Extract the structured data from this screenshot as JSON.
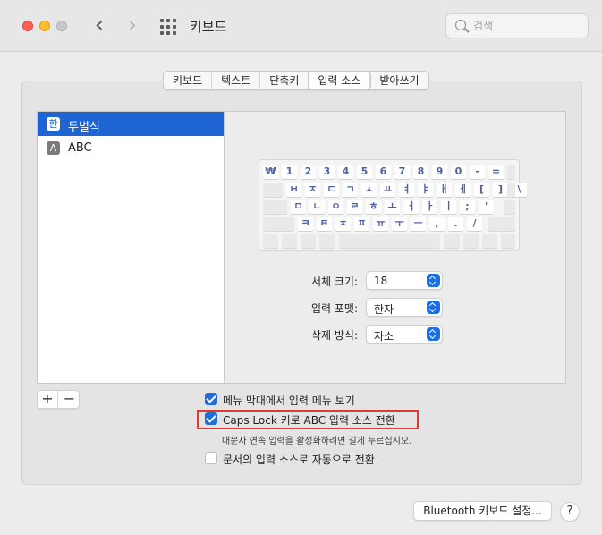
{
  "window": {
    "title": "키보드"
  },
  "search": {
    "placeholder": "검색",
    "value": ""
  },
  "tabs": [
    {
      "label": "키보드",
      "active": false
    },
    {
      "label": "텍스트",
      "active": false
    },
    {
      "label": "단축키",
      "active": false
    },
    {
      "label": "입력 소스",
      "active": true
    },
    {
      "label": "받아쓰기",
      "active": false
    }
  ],
  "sources": [
    {
      "icon": "한",
      "label": "두벌식",
      "selected": true
    },
    {
      "icon": "A",
      "label": "ABC",
      "selected": false
    }
  ],
  "keyboard": {
    "rows": [
      [
        "₩",
        "1",
        "2",
        "3",
        "4",
        "5",
        "6",
        "7",
        "8",
        "9",
        "0",
        "-",
        "="
      ],
      [
        "ㅂ",
        "ㅈ",
        "ㄷ",
        "ㄱ",
        "ㅅ",
        "ㅛ",
        "ㅕ",
        "ㅑ",
        "ㅐ",
        "ㅔ",
        "[",
        "]",
        "\\"
      ],
      [
        "ㅁ",
        "ㄴ",
        "ㅇ",
        "ㄹ",
        "ㅎ",
        "ㅗ",
        "ㅓ",
        "ㅏ",
        "ㅣ",
        ";",
        "'"
      ],
      [
        "ㅋ",
        "ㅌ",
        "ㅊ",
        "ㅍ",
        "ㅠ",
        "ㅜ",
        "ㅡ",
        ",",
        ".",
        "/"
      ]
    ]
  },
  "settings": {
    "font_size_label": "서체 크기:",
    "font_size_value": "18",
    "input_font_label": "입력 포맷:",
    "input_font_value": "한자",
    "delete_mode_label": "삭제 방식:",
    "delete_mode_value": "자소"
  },
  "list_controls": {
    "add": "+",
    "remove": "−"
  },
  "options": {
    "show_menu": {
      "label": "메뉴 막대에서 입력 메뉴 보기",
      "checked": true
    },
    "caps_lock": {
      "label": "Caps Lock 키로 ABC 입력 소스 전환",
      "checked": true
    },
    "caps_hint": "대문자 연속 입력을 활성화하려면 길게 누르십시오.",
    "auto_switch": {
      "label": "문서의 입력 소스로 자동으로 전환",
      "checked": false
    }
  },
  "footer": {
    "bluetooth_label": "Bluetooth 키보드 설정...",
    "help_label": "?"
  },
  "colors": {
    "accent": "#1e6ee0",
    "selection": "#1e64d2",
    "highlight": "#e03a34"
  }
}
